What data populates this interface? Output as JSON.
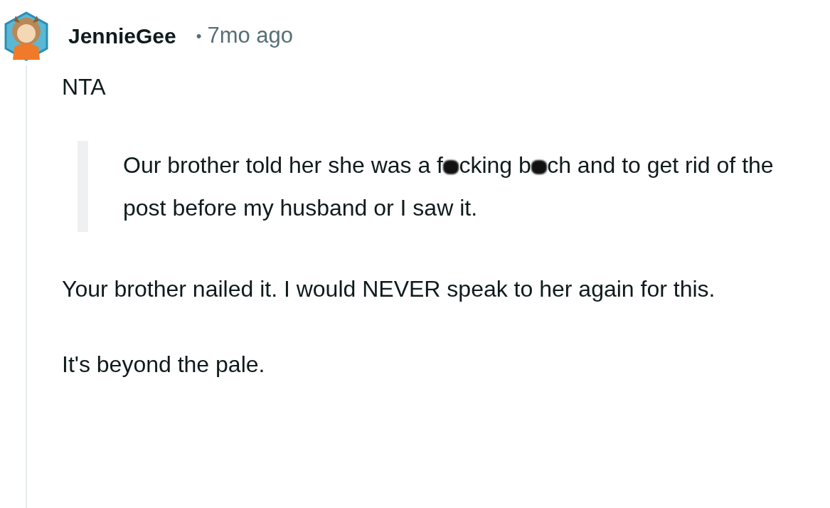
{
  "comment": {
    "author": "JennieGee",
    "separator": "•",
    "time": "7mo ago",
    "body": [
      {
        "kind": "text",
        "text": "NTA"
      },
      {
        "kind": "quote",
        "parts": [
          "Our brother told her she was a f",
          "cking b",
          "ch and to get rid of the post before my husband or I saw it."
        ]
      },
      {
        "kind": "text",
        "text": "Your brother nailed it. I would NEVER speak to her again for this."
      },
      {
        "kind": "text",
        "text": "It's beyond the pale."
      }
    ]
  }
}
